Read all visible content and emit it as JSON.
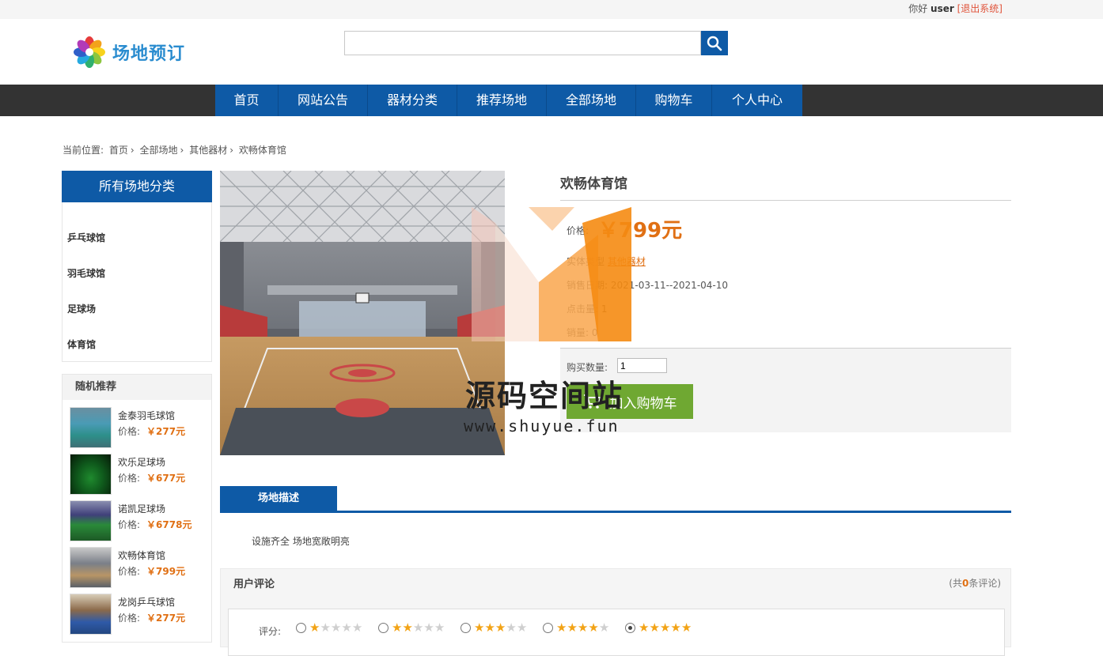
{
  "header": {
    "greeting": "你好",
    "username": "user",
    "logout": "[退出系统]",
    "logo_text": "场地预订"
  },
  "search": {
    "value": "",
    "placeholder": ""
  },
  "nav": [
    "首页",
    "网站公告",
    "器材分类",
    "推荐场地",
    "全部场地",
    "购物车",
    "个人中心"
  ],
  "breadcrumb": {
    "prefix": "当前位置:",
    "items": [
      "首页",
      "全部场地",
      "其他器材",
      "欢畅体育馆"
    ]
  },
  "sidebar": {
    "categories_title": "所有场地分类",
    "categories": [
      "乒乓球馆",
      "羽毛球馆",
      "足球场",
      "体育馆"
    ],
    "recommend_title": "随机推荐",
    "price_label": "价格:",
    "recommend": [
      {
        "name": "金泰羽毛球馆",
        "price": "￥277元"
      },
      {
        "name": "欢乐足球场",
        "price": "￥677元"
      },
      {
        "name": "诺凯足球场",
        "price": "￥6778元"
      },
      {
        "name": "欢畅体育馆",
        "price": "￥799元"
      },
      {
        "name": "龙岗乒乓球馆",
        "price": "￥277元"
      }
    ]
  },
  "product": {
    "name": "欢畅体育馆",
    "price_label": "价格:",
    "price": "￥799元",
    "type_label": "实体类型",
    "type_value": "其他器材",
    "sale_label": "销售日期",
    "sale_period": "2021-03-11--2021-04-10",
    "clicks_label": "点击量",
    "clicks_value": "1",
    "sold_label": "销量:",
    "sold_value": "0",
    "qty_label": "购买数量:",
    "qty_value": "1",
    "add_to_cart": "加入购物车"
  },
  "watermark": {
    "line1": "源码空间站",
    "line2": "www.shuyue.fun"
  },
  "description": {
    "tab": "场地描述",
    "text": "设施齐全 场地宽敞明亮"
  },
  "reviews": {
    "title": "用户评论",
    "count_prefix": "(共",
    "count": "0",
    "count_suffix": "条评论)",
    "score_label": "评分:",
    "selected": 5
  },
  "colors": {
    "primary": "#0e5aa6",
    "accent": "#e07014",
    "cart": "#6fa832",
    "navbar": "#333333"
  }
}
